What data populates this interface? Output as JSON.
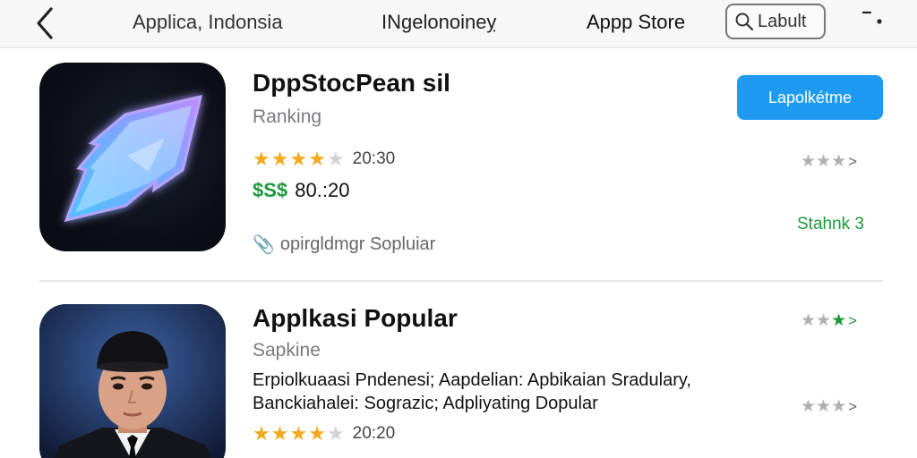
{
  "header": {
    "back_icon": "chevron-left-icon",
    "crumb_1": "Applica, Indonsia",
    "crumb_2": "INgelonoineỵ",
    "store_title": "Appp Store",
    "search_label": "Labult",
    "search_icon": "search-icon",
    "menu_icon": "menu-dots-icon"
  },
  "apps": [
    {
      "title": "DppStocPean sil",
      "subtitle": "Ranking",
      "rating": 4,
      "rating_max": 5,
      "rating_text": "20:30",
      "price_currency": "$S$",
      "price_value": "80.:20",
      "meta_icon": "paperclip-icon",
      "meta_text": "opirgldmgr Sopluiar",
      "button_label": "Lapolkétme",
      "side_rating_arrow": ">",
      "status_text": "Stahnk 3",
      "accent": "#1e9bf0"
    },
    {
      "title": "Applkasi Popular",
      "subtitle": "Sapkine",
      "description_1": "Erpiolkuaasi Pndenesi; Aapdelian: Apbikaian Sradulary,",
      "description_2": "Banckiahalei: Sograzic; Adpliyating Dopular",
      "rating": 4,
      "rating_max": 5,
      "rating_text": "20:20",
      "side_rating_arrow_top": ">",
      "side_rating_arrow_mid": ">"
    }
  ],
  "colors": {
    "star": "#f2a91c",
    "price_green": "#1c9a3a",
    "button_blue": "#1e9bf0"
  }
}
